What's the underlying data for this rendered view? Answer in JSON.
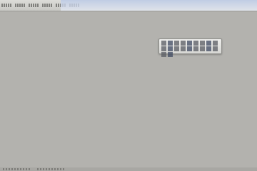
{
  "window": {
    "background_color": "#b3b2ae"
  },
  "menubar": {
    "items": [
      {
        "label": ""
      },
      {
        "label": ""
      },
      {
        "label": ""
      },
      {
        "label": ""
      },
      {
        "label": ""
      },
      {
        "label": ""
      }
    ]
  },
  "toolbar": {
    "buttons": [
      {
        "icon": "cursor-icon"
      },
      {
        "icon": "hand-icon"
      },
      {
        "icon": "zoom-in-icon"
      },
      {
        "icon": "zoom-out-icon"
      },
      {
        "icon": "pencil-icon"
      },
      {
        "icon": "line-icon"
      },
      {
        "icon": "rectangle-icon"
      },
      {
        "icon": "ellipse-icon"
      },
      {
        "icon": "text-icon"
      },
      {
        "icon": "fill-icon"
      },
      {
        "icon": "eraser-icon"
      },
      {
        "icon": "color-picker-icon"
      },
      {
        "icon": "undo-icon"
      },
      {
        "icon": "redo-icon"
      },
      {
        "icon": "copy-icon"
      },
      {
        "icon": "paste-icon"
      },
      {
        "icon": "crop-icon"
      },
      {
        "icon": "rotate-icon"
      },
      {
        "icon": "flip-icon"
      },
      {
        "icon": "grid-icon"
      }
    ]
  }
}
